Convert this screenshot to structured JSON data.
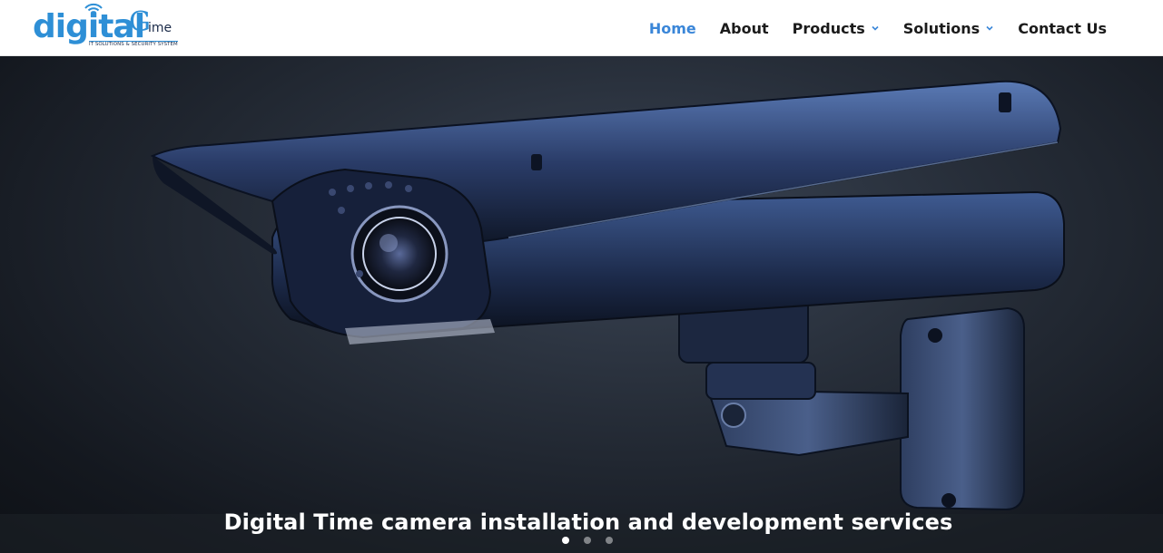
{
  "brand": {
    "logo_main": "digital",
    "logo_g": "G",
    "logo_time": "ime",
    "tagline": "IT SOLUTIONS & SECURITY SYSTEM",
    "primary_color": "#2e8fd6",
    "dark_color": "#1a2a48"
  },
  "nav": {
    "items": [
      {
        "label": "Home",
        "active": true,
        "has_dropdown": false
      },
      {
        "label": "About",
        "active": false,
        "has_dropdown": false
      },
      {
        "label": "Products",
        "active": false,
        "has_dropdown": true
      },
      {
        "label": "Solutions",
        "active": false,
        "has_dropdown": true
      },
      {
        "label": "Contact Us",
        "active": false,
        "has_dropdown": false
      }
    ],
    "active_color": "#3a86d8",
    "dropdown_icon": "chevron-down-icon"
  },
  "hero": {
    "image": "security-camera-image",
    "caption": "Digital Time camera installation and development services",
    "slides": 3,
    "active_slide": 1
  }
}
